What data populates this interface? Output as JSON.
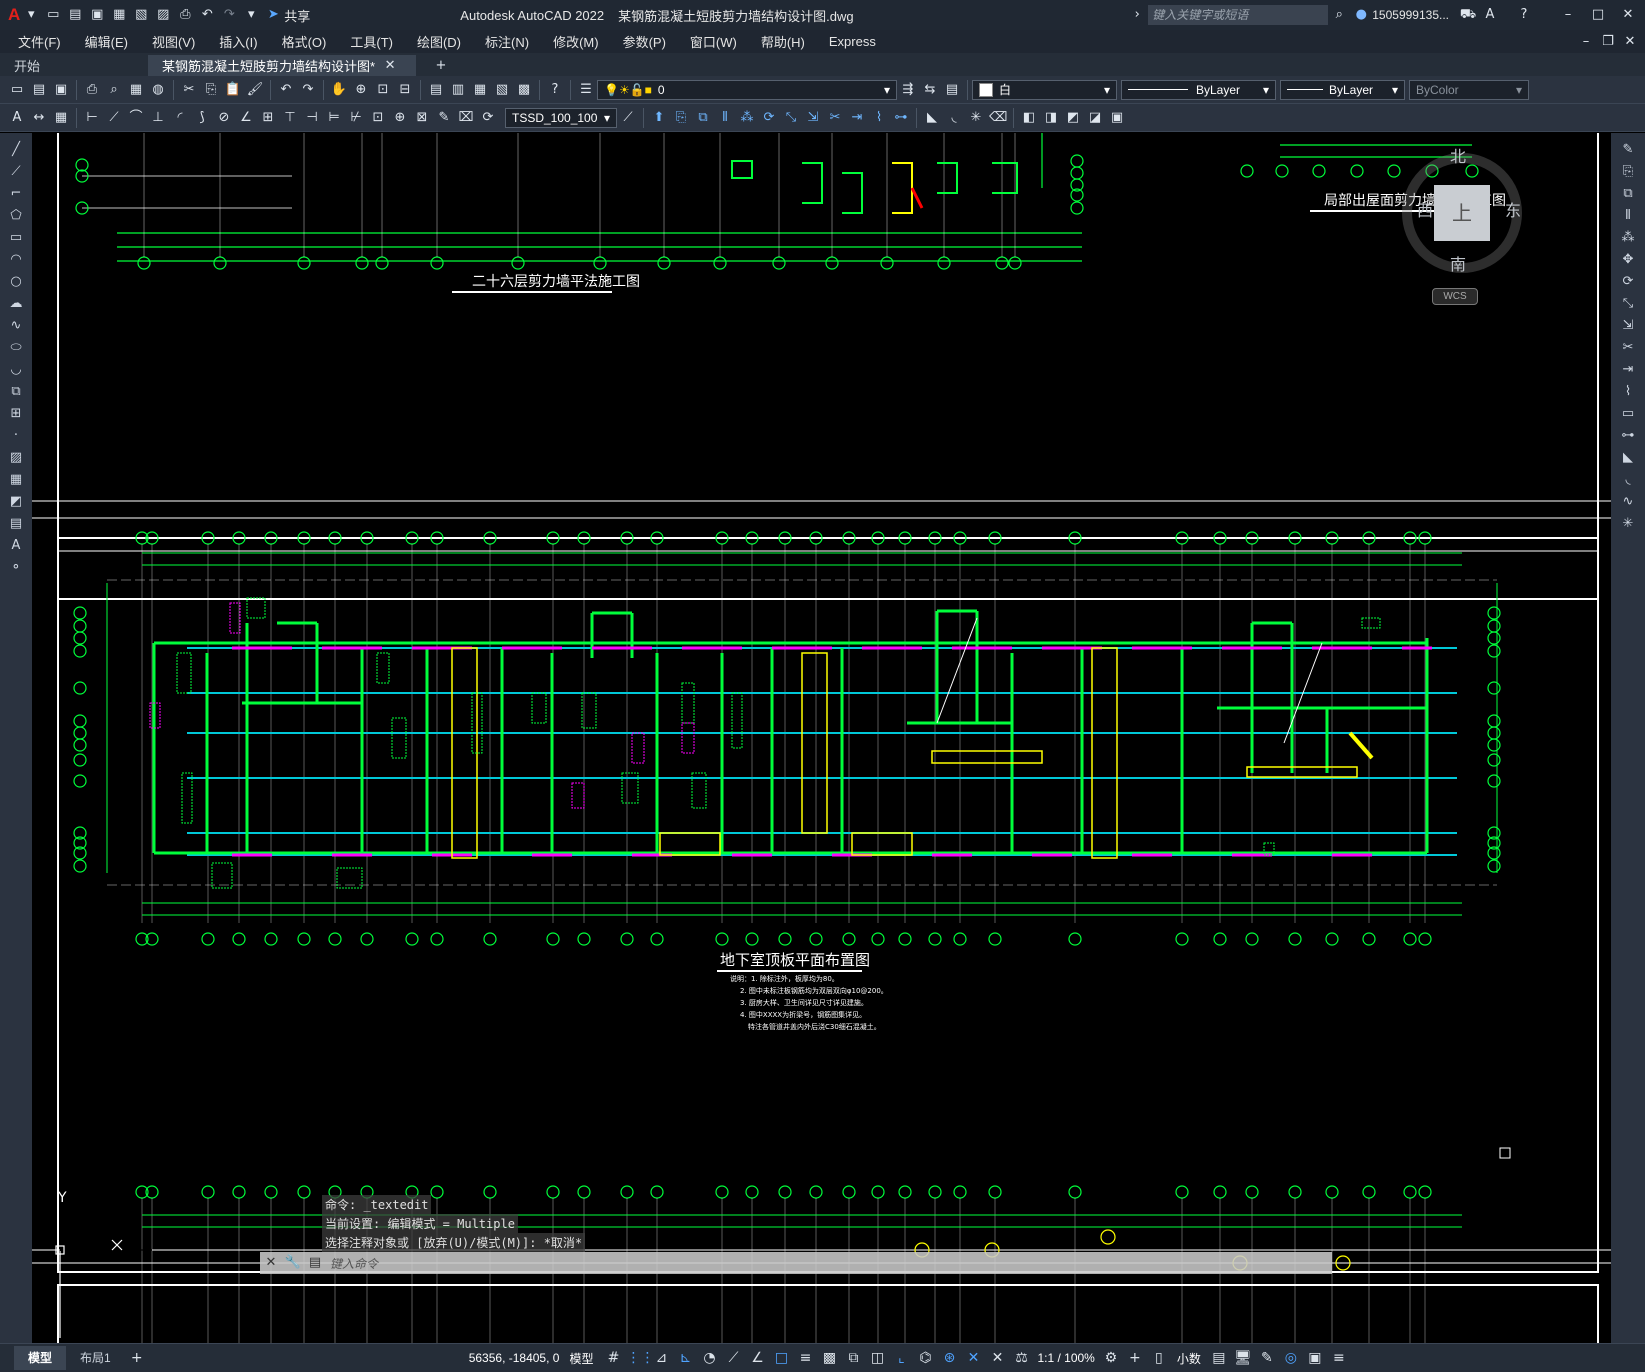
{
  "window": {
    "app_title": "Autodesk AutoCAD 2022",
    "file_name": "某钢筋混凝土短肢剪力墙结构设计图.dwg",
    "share_label": "共享",
    "search_placeholder": "键入关键字或短语",
    "user_name": "1505999135..."
  },
  "menu": [
    "文件(F)",
    "编辑(E)",
    "视图(V)",
    "插入(I)",
    "格式(O)",
    "工具(T)",
    "绘图(D)",
    "标注(N)",
    "修改(M)",
    "参数(P)",
    "窗口(W)",
    "帮助(H)",
    "Express"
  ],
  "tabs": {
    "start": "开始",
    "active": "某钢筋混凝土短肢剪力墙结构设计图*"
  },
  "properties": {
    "layer": "0",
    "color": "白",
    "linetype": "ByLayer",
    "lineweight": "ByLayer",
    "plotstyle": "ByColor",
    "text_style": "TSSD_100_100"
  },
  "viewcube": {
    "north": "北",
    "south": "南",
    "east": "东",
    "west": "西",
    "face": "上",
    "wcs": "WCS"
  },
  "drawing": {
    "title_top": "二十六层剪力墙平法施工图",
    "title_top_right": "局部出屋面剪力墙平法施工图",
    "title_main": "地下室顶板平面布置图",
    "notes": [
      "说明：1. 除标注外，板厚均为80。",
      "2. 图中未标注板钢筋均为双层双向φ10@200。",
      "3. 厨房大样、卫生间详见尺寸详见建施。",
      "4. 图中XXXX为折梁号，钢筋图集详见。",
      "特注各管道井盖内外后浇C30细石混凝土。"
    ],
    "ucs_y": "Y"
  },
  "command": {
    "line1": "命令: _textedit",
    "line2": "当前设置: 编辑模式 = Multiple",
    "line3": "选择注释对象或 [放弃(U)/模式(M)]: *取消*",
    "placeholder": "键入命令"
  },
  "status": {
    "tab_model": "模型",
    "tab_layout": "布局1",
    "coords": "56356, -18405, 0",
    "space": "模型",
    "scale": "1:1 / 100%",
    "units": "小数"
  }
}
